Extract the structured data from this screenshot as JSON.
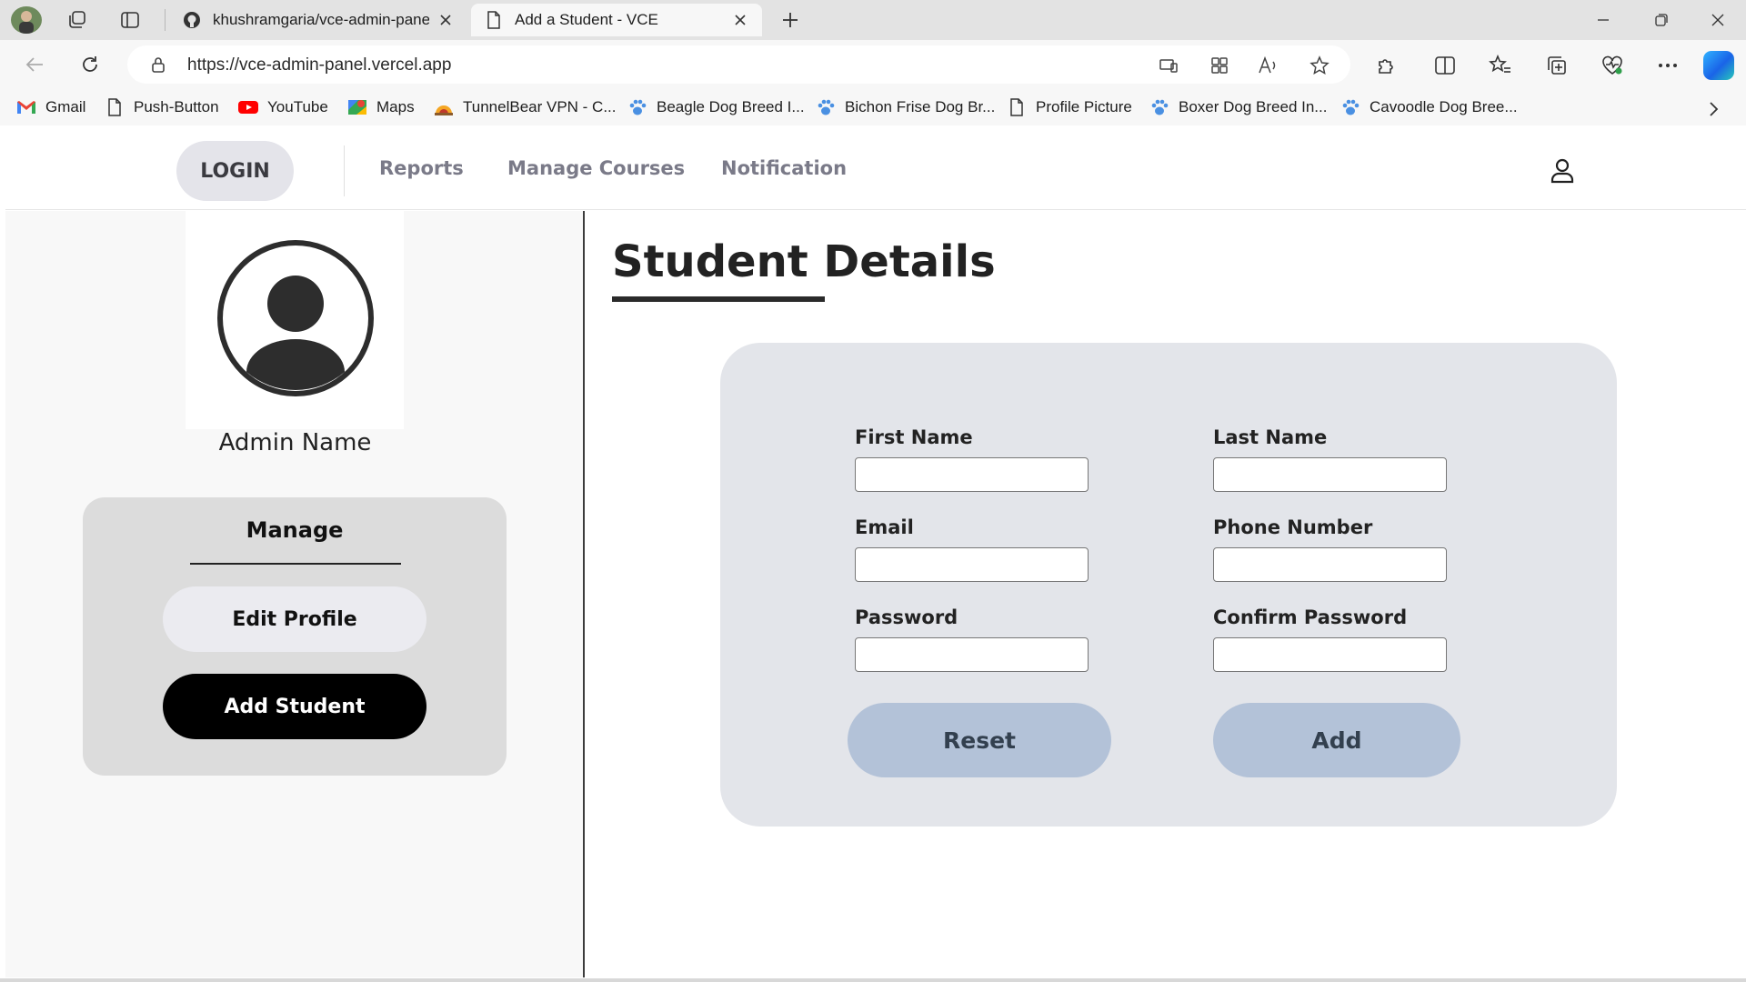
{
  "browser": {
    "tabs": [
      {
        "title": "khushramgaria/vce-admin-panel",
        "icon": "github-icon",
        "active": false
      },
      {
        "title": "Add a Student - VCE",
        "icon": "page-icon",
        "active": true
      }
    ],
    "url": "https://vce-admin-panel.vercel.app",
    "bookmarks": [
      {
        "label": "Gmail",
        "icon": "gmail-icon"
      },
      {
        "label": "Push-Button",
        "icon": "page-icon"
      },
      {
        "label": "YouTube",
        "icon": "youtube-icon"
      },
      {
        "label": "Maps",
        "icon": "maps-icon"
      },
      {
        "label": "TunnelBear VPN - C...",
        "icon": "tunnelbear-icon"
      },
      {
        "label": "Beagle Dog Breed I...",
        "icon": "paw-icon"
      },
      {
        "label": "Bichon Frise Dog Br...",
        "icon": "paw-icon"
      },
      {
        "label": "Profile Picture",
        "icon": "page-icon"
      },
      {
        "label": "Boxer Dog Breed In...",
        "icon": "paw-icon"
      },
      {
        "label": "Cavoodle Dog Bree...",
        "icon": "paw-icon"
      }
    ]
  },
  "nav": {
    "login": "LOGIN",
    "links": [
      "Reports",
      "Manage Courses",
      "Notification"
    ]
  },
  "sidebar": {
    "admin_name": "Admin Name",
    "manage_title": "Manage",
    "edit_profile": "Edit Profile",
    "add_student": "Add Student"
  },
  "main": {
    "title": "Student Details",
    "form": {
      "first_name": "First Name",
      "last_name": "Last Name",
      "email": "Email",
      "phone": "Phone Number",
      "password": "Password",
      "confirm_password": "Confirm Password",
      "reset": "Reset",
      "add": "Add"
    }
  },
  "colors": {
    "form_card_bg": "#e3e5ea",
    "form_button_bg": "#b3c2d8",
    "manage_card_bg": "#dcdcdc",
    "add_student_bg": "#000000",
    "login_pill_bg": "#e4e4ea"
  }
}
